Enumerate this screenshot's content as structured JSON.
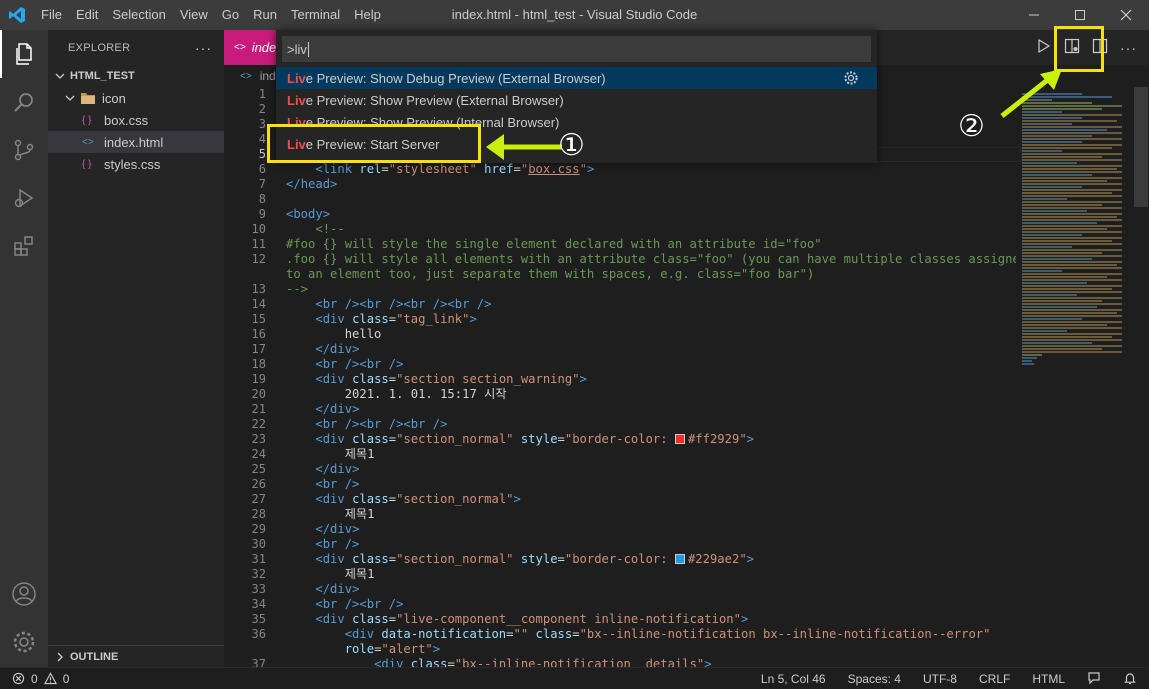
{
  "window": {
    "title": "index.html - html_test - Visual Studio Code",
    "menu": [
      "File",
      "Edit",
      "Selection",
      "View",
      "Go",
      "Run",
      "Terminal",
      "Help"
    ]
  },
  "sidebar": {
    "header": "EXPLORER",
    "project": "HTML_TEST",
    "items": [
      {
        "label": "icon",
        "type": "folder"
      },
      {
        "label": "box.css",
        "type": "css"
      },
      {
        "label": "index.html",
        "type": "html"
      },
      {
        "label": "styles.css",
        "type": "css"
      }
    ],
    "outline": "OUTLINE"
  },
  "editor": {
    "tab_label": "inde",
    "breadcrumb": "inde"
  },
  "palette": {
    "query": ">liv",
    "items": [
      {
        "hl": "Liv",
        "rest": "e Preview: Show Debug Preview (External Browser)"
      },
      {
        "hl": "Liv",
        "rest": "e Preview: Show Preview (External Browser)"
      },
      {
        "hl": "Liv",
        "rest": "e Preview: Show Preview (Internal Browser)"
      },
      {
        "hl": "Liv",
        "rest": "e Preview: Start Server"
      }
    ]
  },
  "annotations": {
    "callout1": "①",
    "callout2": "②",
    "box_color": "#f8e00b",
    "arrow_color": "#c8f00a"
  },
  "code": {
    "line_numbers": [
      "1",
      "2",
      "3",
      "4",
      "5",
      "6",
      "7",
      "8",
      "9",
      "10",
      "11",
      "12",
      "",
      "13",
      "14",
      "15",
      "16",
      "17",
      "18",
      "19",
      "20",
      "21",
      "22",
      "23",
      "24",
      "25",
      "26",
      "27",
      "28",
      "29",
      "30",
      "31",
      "32",
      "33",
      "34",
      "35",
      "36",
      "",
      "37"
    ],
    "l6_tag": "link",
    "l6_rel": "rel",
    "l6_rel_v": "\"stylesheet\"",
    "l6_href": "href",
    "l6_href_v": "box.css",
    "l7": "head",
    "l9": "body",
    "l10": "<!--",
    "l11": "#foo {} will style the single element declared with an attribute id=\"foo\"",
    "l12a": ".foo {} will style all elements with an attribute class=\"foo\" (you can have multiple classes assigned",
    "l12b": "to an element too, just separate them with spaces, e.g. class=\"foo bar\")",
    "l13": "-->",
    "br4": "<br /><br /><br /><br />",
    "br3": "<br /><br /><br />",
    "br2": "<br /><br />",
    "br1": "<br />",
    "div": "div",
    "class": "class",
    "tag_link": "\"tag_link\"",
    "hello": "hello",
    "section_warning": "\"section section_warning\"",
    "date": "2021. 1. 01. 15:17 시작",
    "section_normal": "\"section_normal\"",
    "style": "style",
    "style_v1_pre": "\"border-color: ",
    "color1": "#ff2929",
    "style_v_post": "\"",
    "jemok": "제목1",
    "color2": "#229ae2",
    "live_comp": "\"live-component__component inline-notification\"",
    "data_notif": "data-notification",
    "empty": "\"\"",
    "bx_class": "\"bx--inline-notification bx--inline-notification--error\"",
    "role": "role",
    "alert": "\"alert\"",
    "details": "\"bx--inline-notification__details\""
  },
  "status": {
    "errors": "0",
    "warnings": "0",
    "position": "Ln 5, Col 46",
    "spaces": "Spaces: 4",
    "encoding": "UTF-8",
    "eol": "CRLF",
    "language": "HTML"
  },
  "colors": {
    "swatch1": "#ff2929",
    "swatch2": "#229ae2"
  }
}
